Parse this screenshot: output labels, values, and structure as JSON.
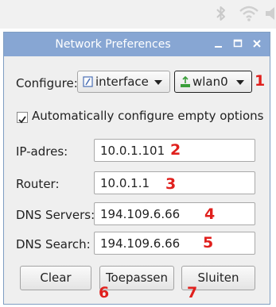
{
  "window": {
    "title": "Network Preferences"
  },
  "configure": {
    "label": "Configure:",
    "type_value": "interface",
    "device_value": "wlan0"
  },
  "auto_option": {
    "label": "Automatically configure empty options",
    "checked": true
  },
  "fields": {
    "ip": {
      "label": "IP-adres:",
      "value": "10.0.1.101"
    },
    "router": {
      "label": "Router:",
      "value": "10.0.1.1"
    },
    "dns_servers": {
      "label": "DNS Servers:",
      "value": "194.109.6.66"
    },
    "dns_search": {
      "label": "DNS Search:",
      "value": "194.109.6.66"
    }
  },
  "buttons": {
    "clear": "Clear",
    "apply": "Toepassen",
    "close": "Sluiten"
  },
  "markers": [
    "1",
    "2",
    "3",
    "4",
    "5",
    "6",
    "7"
  ],
  "colors": {
    "titlebar": "#87a6d3",
    "marker": "#e0201d",
    "tray_icon": "#c9c9c9",
    "network_icon": "#3a9e3a"
  },
  "tray_icons": [
    "bluetooth-icon",
    "wifi-icon",
    "volume-icon"
  ]
}
